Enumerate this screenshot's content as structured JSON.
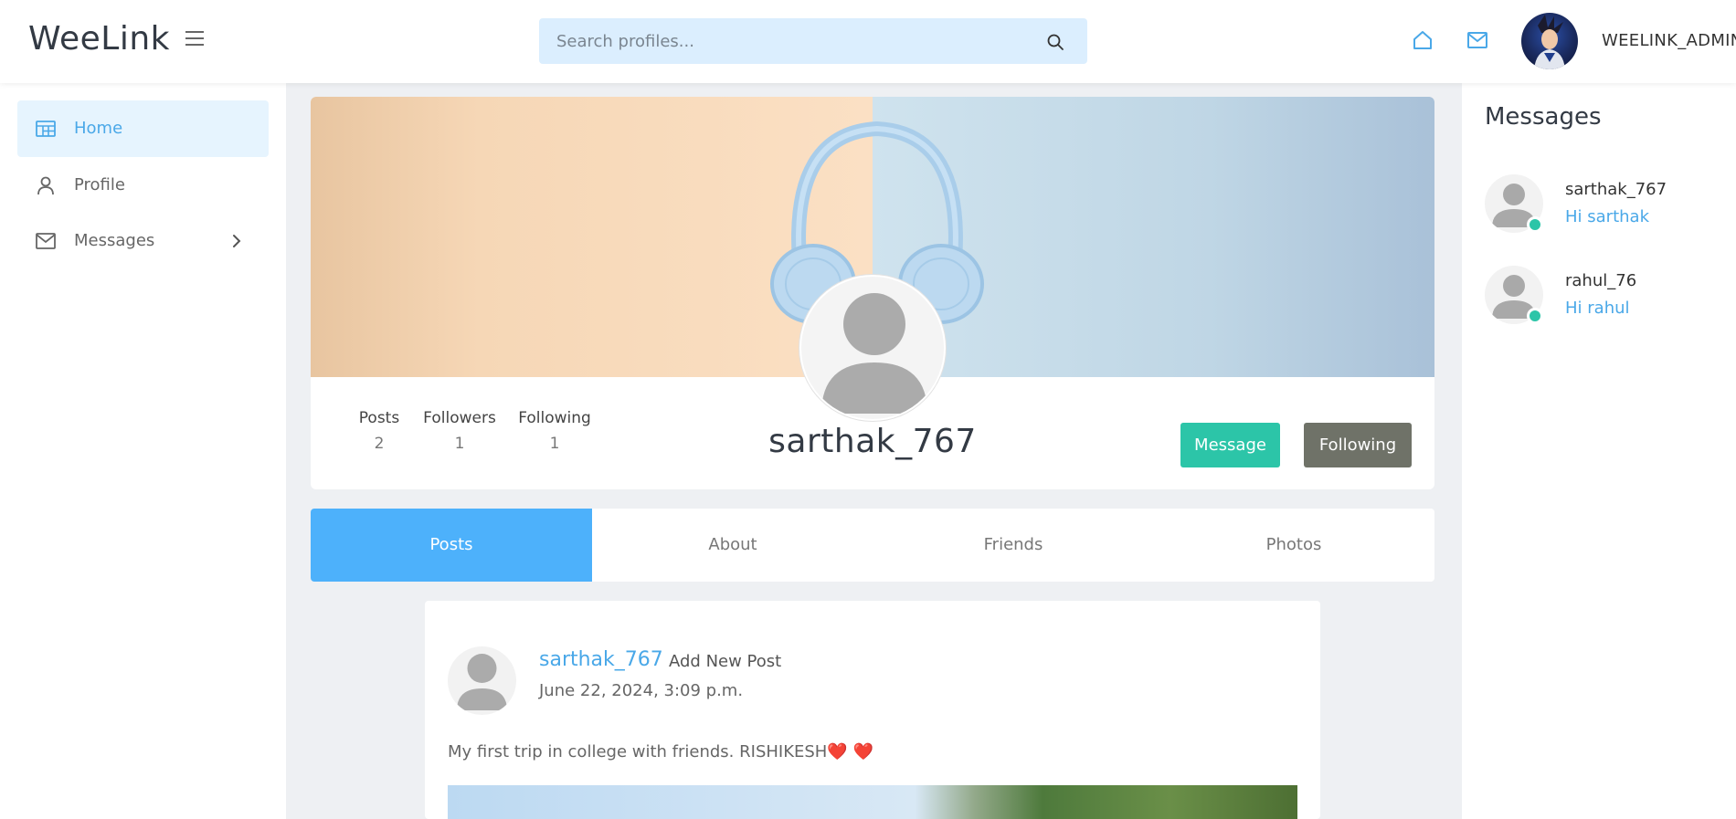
{
  "header": {
    "logo": "WeeLink",
    "search_placeholder": "Search profiles...",
    "username": "WEELINK_ADMIN"
  },
  "sidebar": {
    "items": [
      {
        "label": "Home",
        "icon": "home-icon",
        "active": true
      },
      {
        "label": "Profile",
        "icon": "user-icon",
        "active": false
      },
      {
        "label": "Messages",
        "icon": "mail-icon",
        "active": false
      }
    ]
  },
  "profile": {
    "username": "sarthak_767",
    "stats": [
      {
        "label": "Posts",
        "value": "2"
      },
      {
        "label": "Followers",
        "value": "1"
      },
      {
        "label": "Following",
        "value": "1"
      }
    ],
    "message_button": "Message",
    "following_button": "Following"
  },
  "tabs": [
    {
      "label": "Posts",
      "active": true
    },
    {
      "label": "About",
      "active": false
    },
    {
      "label": "Friends",
      "active": false
    },
    {
      "label": "Photos",
      "active": false
    }
  ],
  "post": {
    "author": "sarthak_767",
    "action": "Add New Post",
    "date": "June 22, 2024, 3:09 p.m.",
    "text": "My first trip in college with friends. RISHIKESH❤️ ❤️"
  },
  "messages_panel": {
    "title": "Messages",
    "items": [
      {
        "name": "sarthak_767",
        "preview": "Hi sarthak",
        "online": true
      },
      {
        "name": "rahul_76",
        "preview": "Hi rahul",
        "online": true
      }
    ]
  },
  "colors": {
    "accent": "#4db1fb",
    "link": "#4aa8e8",
    "message_button": "#2cc5a8",
    "following_button": "#6f7268",
    "online": "#2cc5a8",
    "search_bg": "#dbeefe"
  }
}
